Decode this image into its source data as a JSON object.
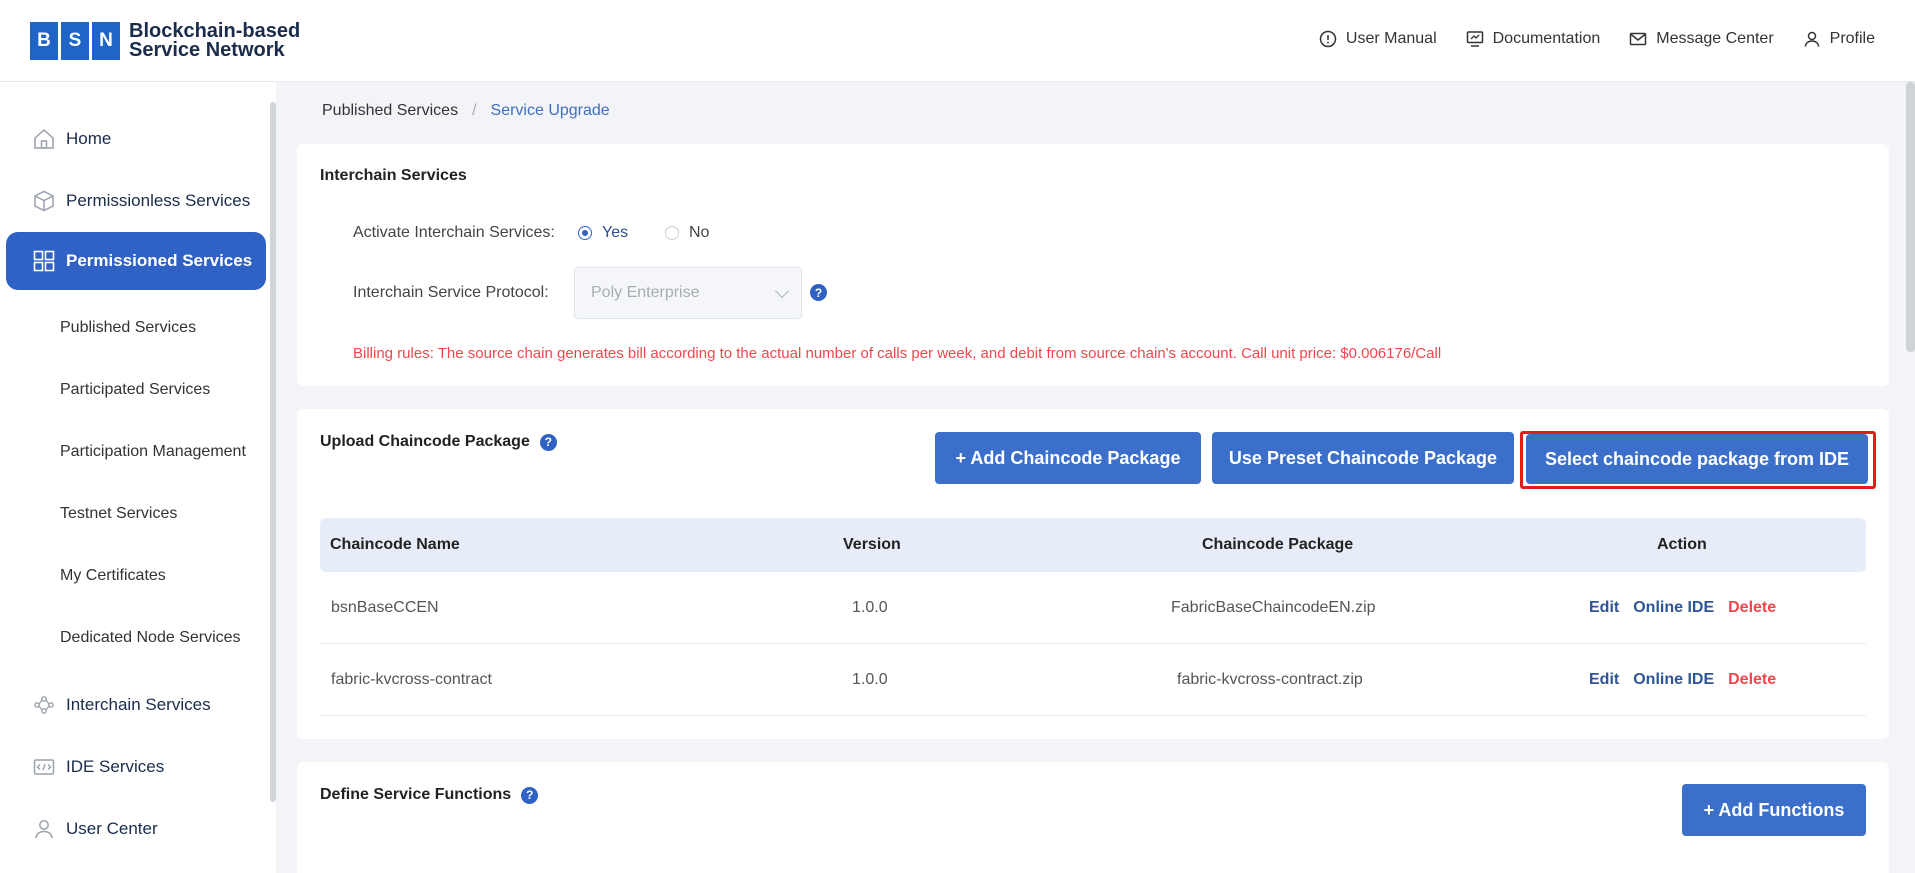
{
  "header": {
    "logo_letters": [
      "B",
      "S",
      "N"
    ],
    "logo_line1": "Blockchain-based",
    "logo_line2": "Service Network",
    "nav": [
      {
        "label": "User Manual",
        "icon": "help-circle-icon"
      },
      {
        "label": "Documentation",
        "icon": "monitor-icon"
      },
      {
        "label": "Message Center",
        "icon": "mail-icon"
      },
      {
        "label": "Profile",
        "icon": "user-icon"
      }
    ]
  },
  "sidebar": {
    "items": [
      {
        "label": "Home",
        "icon": "home-icon"
      },
      {
        "label": "Permissionless Services",
        "icon": "cube-icon"
      },
      {
        "label": "Permissioned Services",
        "icon": "grid-icon",
        "active": true
      },
      {
        "label": "Interchain Services",
        "icon": "network-icon"
      },
      {
        "label": "IDE Services",
        "icon": "ide-icon"
      },
      {
        "label": "User Center",
        "icon": "user-icon"
      }
    ],
    "sub_items": [
      "Published Services",
      "Participated Services",
      "Participation Management",
      "Testnet Services",
      "My Certificates",
      "Dedicated Node Services"
    ]
  },
  "breadcrumb": {
    "parent": "Published Services",
    "separator": "/",
    "current": "Service Upgrade"
  },
  "interchain": {
    "title": "Interchain Services",
    "activate_label": "Activate Interchain Services:",
    "yes_label": "Yes",
    "no_label": "No",
    "selected": "Yes",
    "protocol_label": "Interchain Service Protocol:",
    "protocol_value": "Poly Enterprise",
    "billing": "Billing rules: The source chain generates bill according to the actual number of calls per week, and debit from source chain's account. Call unit price: $0.006176/Call"
  },
  "upload": {
    "title": "Upload Chaincode Package",
    "add_button": "+ Add Chaincode Package",
    "preset_button": "Use Preset Chaincode Package",
    "ide_button": "Select chaincode package from IDE",
    "columns": [
      "Chaincode Name",
      "Version",
      "Chaincode Package",
      "Action"
    ],
    "rows": [
      {
        "name": "bsnBaseCCEN",
        "version": "1.0.0",
        "package": "FabricBaseChaincodeEN.zip"
      },
      {
        "name": "fabric-kvcross-contract",
        "version": "1.0.0",
        "package": "fabric-kvcross-contract.zip"
      }
    ],
    "actions": {
      "edit": "Edit",
      "ide": "Online IDE",
      "delete": "Delete"
    }
  },
  "functions": {
    "title": "Define Service Functions",
    "add_button": "+ Add Functions"
  },
  "colors": {
    "accent": "#2f62c4",
    "danger": "#f0474c",
    "highlight": "#e31c1c"
  }
}
